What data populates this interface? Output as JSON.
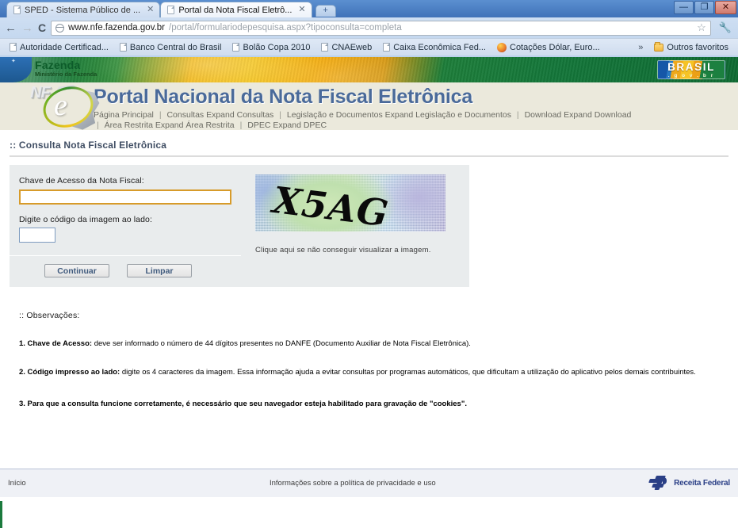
{
  "browser": {
    "tabs": [
      {
        "title": "SPED - Sistema Público de ...",
        "active": false
      },
      {
        "title": "Portal da Nota Fiscal Eletrô...",
        "active": true
      }
    ],
    "new_tab_label": "+",
    "window_controls": {
      "minimize": "—",
      "maximize": "❐",
      "close": "✕"
    },
    "back_label": "←",
    "forward_label": "→",
    "reload_label": "C",
    "url_host": "www.nfe.fazenda.gov.br",
    "url_path": "/portal/formulariodepesquisa.aspx?tipoconsulta=completa",
    "star_label": "☆",
    "wrench_label": "🔧",
    "bookmarks": [
      "Autoridade Certificad...",
      "Banco Central do Brasil",
      "Bolão Copa 2010",
      "CNAEweb",
      "Caixa Econômica Fed...",
      "Cotações Dólar, Euro..."
    ],
    "overflow_label": "»",
    "other_bookmarks": "Outros favoritos"
  },
  "gov_banner": {
    "ministry_name": "Fazenda",
    "ministry_sub": "Ministério da Fazenda",
    "brasil_logo_top": "BRASIL",
    "brasil_logo_bottom": ". g o v . b r"
  },
  "portal": {
    "logo_nf": "NF",
    "logo_e": "e",
    "title": "Portal Nacional da Nota Fiscal Eletrônica",
    "nav_row1": [
      "Página Principal",
      "Consultas Expand Consultas",
      "Legislação e Documentos Expand Legislação e Documentos",
      "Download Expand Download"
    ],
    "nav_row2": [
      "Área Restrita Expand Área Restrita",
      "DPEC Expand DPEC"
    ]
  },
  "main": {
    "page_title": ":: Consulta Nota Fiscal Eletrônica",
    "label_chave": "Chave de Acesso da Nota Fiscal:",
    "value_chave": "",
    "label_codigo": "Digite o código da imagem ao lado:",
    "value_codigo": "",
    "button_continuar": "Continuar",
    "button_limpar": "Limpar",
    "captcha_text": "X5AG",
    "captcha_hint": "Clique aqui se não conseguir visualizar a imagem."
  },
  "observations": {
    "title": ":: Observações:",
    "items": [
      {
        "bold": "1. Chave de Acesso:",
        "text": " deve ser informado o número de 44 dígitos presentes no DANFE (Documento Auxiliar de Nota Fiscal Eletrônica)."
      },
      {
        "bold": "2. Código impresso ao lado:",
        "text": " digite os 4 caracteres da imagem. Essa informação ajuda a evitar consultas por programas automáticos, que dificultam a utilização do aplicativo pelos demais contribuintes."
      },
      {
        "bold": "3. Para que a consulta funcione corretamente,",
        "text": " é necessário que seu navegador esteja habilitado para gravação de \"cookies\"."
      }
    ]
  },
  "footer": {
    "inicio": "Início",
    "privacy": "Informações sobre a política de privacidade e uso",
    "agency": "Receita Federal"
  },
  "colors": {
    "accent_focus": "#d79b2a",
    "portal_title": "#4a6a9a",
    "banner_green": "#1b7a3d",
    "banner_yellow": "#f5c417",
    "form_bg": "#e9eced",
    "agency_blue": "#2a3f86"
  }
}
